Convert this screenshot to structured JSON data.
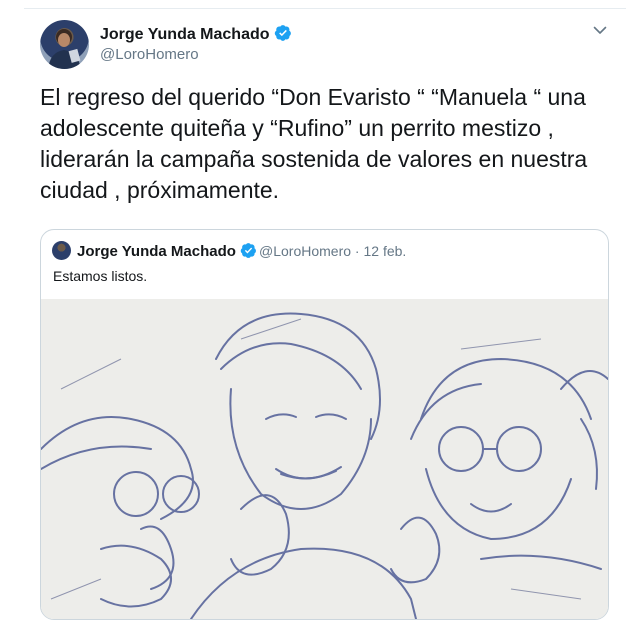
{
  "tweet": {
    "author_name": "Jorge Yunda Machado",
    "handle": "@LoroHomero",
    "text": "El regreso del querido “Don Evaristo “ “Manuela “ una adolescente quiteña y “Rufino” un perrito mestizo , liderarán la campaña sostenida de valores en nuestra ciudad , próximamente.",
    "verified_icon": "verified-badge-icon",
    "menu_icon": "chevron-down-icon"
  },
  "quoted_tweet": {
    "author_name": "Jorge Yunda Machado",
    "handle": "@LoroHomero",
    "separator": "·",
    "date": "12 feb.",
    "text": "Estamos listos.",
    "image": "pencil-sketch-illustration"
  },
  "colors": {
    "accent": "#1da1f2",
    "secondary_text": "#657786",
    "border": "#ccd6dd"
  }
}
